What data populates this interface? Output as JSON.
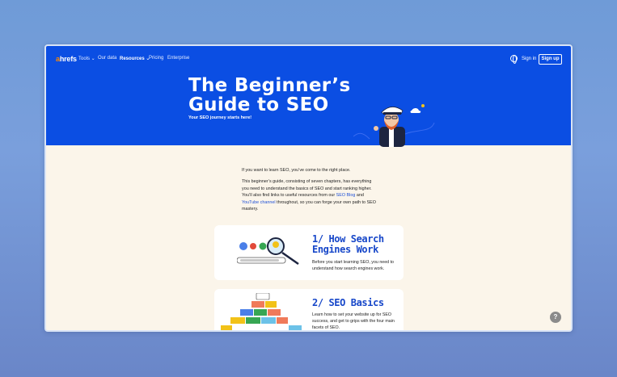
{
  "nav": {
    "logo_a": "a",
    "logo_rest": "hrefs",
    "items": [
      {
        "label": "Tools ⌄"
      },
      {
        "label": "Our data"
      },
      {
        "label": "Resources ⌄"
      },
      {
        "label": "Pricing"
      },
      {
        "label": "Enterprise"
      }
    ],
    "signin": "Sign in",
    "signup": "Sign up"
  },
  "hero": {
    "title_line1": "The Beginner’s",
    "title_line2": "Guide to SEO",
    "subtitle": "Your SEO journey starts here!"
  },
  "intro": {
    "p1": "If you want to learn SEO, you’ve come to the right place.",
    "p2_a": "This beginner’s guide, consisting of seven chapters, has everything you need to understand the basics of SEO and start ranking higher. You’ll also find links to useful resources from our ",
    "p2_link1": "SEO Blog",
    "p2_b": " and ",
    "p2_link2": "YouTube channel",
    "p2_c": " throughout, so you can forge your own path to SEO mastery."
  },
  "chapters": [
    {
      "title_line1": "1/ How Search",
      "title_line2": "Engines Work",
      "desc": "Before you start learning SEO, you need to understand how search engines work."
    },
    {
      "title_line1": "2/ SEO Basics",
      "desc": "Learn how to set your website up for SEO success, and get to grips with the four main facets of SEO."
    }
  ],
  "help": {
    "label": "?"
  },
  "colors": {
    "hero_bg": "#0b4ee3",
    "page_bg": "#fbf5ea",
    "accent_title": "#1747c9",
    "logo_accent": "#ff8800"
  }
}
